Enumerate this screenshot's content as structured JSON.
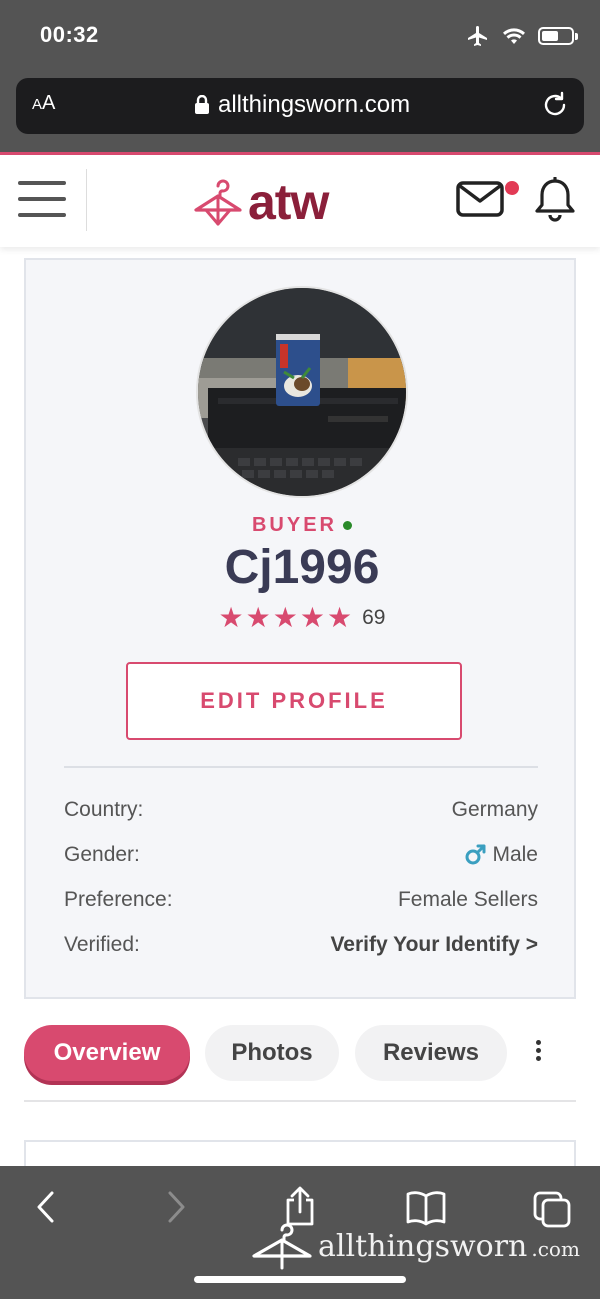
{
  "status_bar": {
    "time": "00:32"
  },
  "browser": {
    "text_size_label": "AA",
    "url": "allthingsworn.com"
  },
  "site": {
    "logo_text": "atw"
  },
  "profile": {
    "role": "BUYER",
    "username": "Cj1996",
    "rating_stars": 5,
    "rating_count": "69",
    "edit_button": "EDIT PROFILE",
    "details": [
      {
        "label": "Country:",
        "value": "Germany"
      },
      {
        "label": "Gender:",
        "value": "Male"
      },
      {
        "label": "Preference:",
        "value": "Female Sellers"
      },
      {
        "label": "Verified:",
        "value": "Verify Your Identify >"
      }
    ]
  },
  "tabs": [
    {
      "label": "Overview",
      "active": true
    },
    {
      "label": "Photos",
      "active": false
    },
    {
      "label": "Reviews",
      "active": false
    }
  ],
  "watermark": {
    "text": "allthingsworn",
    "domain": ".com"
  },
  "colors": {
    "accent": "#d84a6f",
    "brand_dark": "#8b1f3a",
    "gender_icon": "#3a9fc0"
  }
}
